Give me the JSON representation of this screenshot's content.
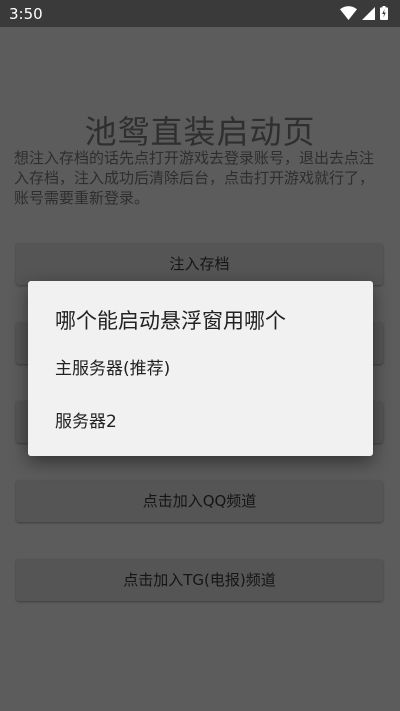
{
  "status_bar": {
    "time": "3:50",
    "icons": [
      "wifi-icon",
      "cellular-signal-icon",
      "battery-charging-icon"
    ]
  },
  "app": {
    "title": "池鸳直装启动页",
    "description": "想注入存档的话先点打开游戏去登录账号，退出去点注入存档，注入成功后清除后台，点击打开游戏就行了，账号需要重新登录。",
    "buttons": {
      "inject_save": "注入存档",
      "join_qq": "点击加入QQ频道",
      "join_tg": "点击加入TG(电报)频道"
    }
  },
  "dialog": {
    "title": "哪个能启动悬浮窗用哪个",
    "options": [
      "主服务器(推荐)",
      "服务器2"
    ]
  },
  "colors": {
    "status_bar_bg": "#3a3a3a",
    "dimmed_background": "#5c5c5c",
    "dialog_bg": "#f1f1f1"
  }
}
